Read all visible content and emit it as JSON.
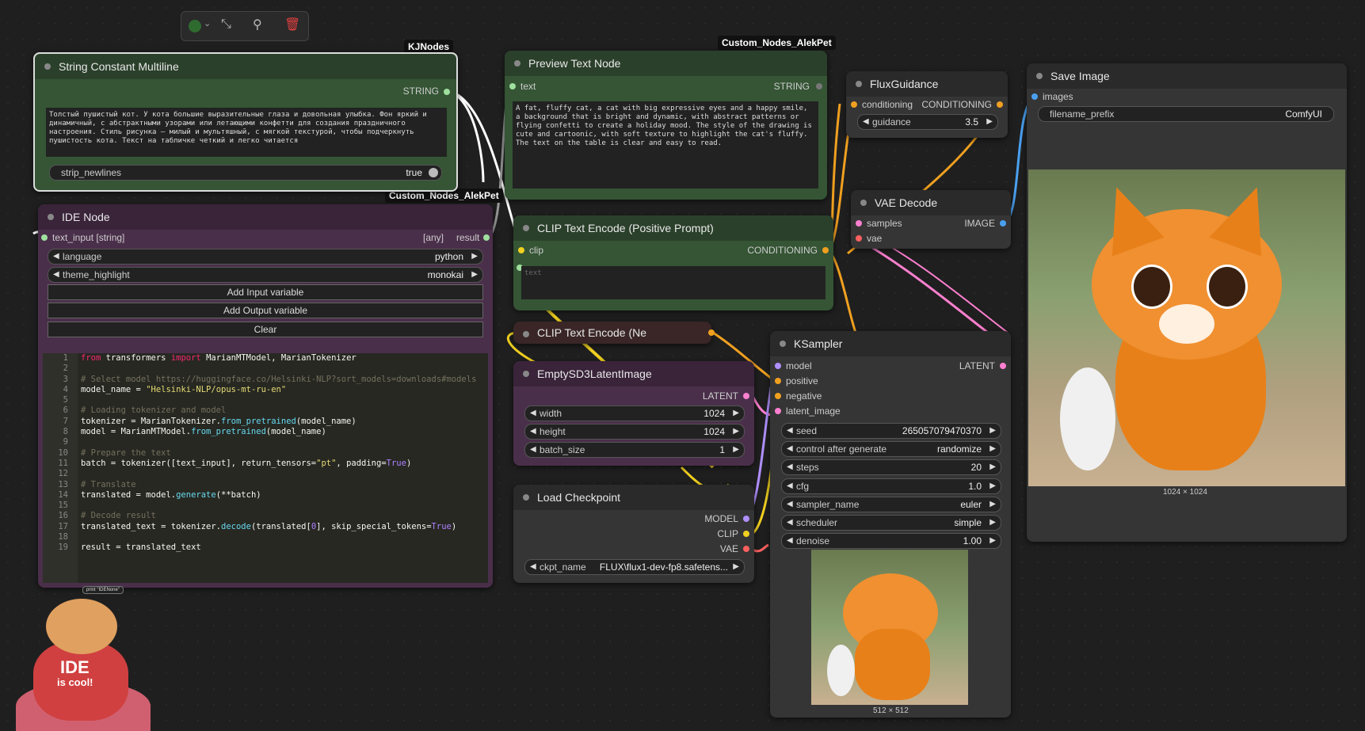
{
  "toolbar": {
    "icons": [
      "color-picker-icon",
      "bypass-icon",
      "pin-icon",
      "delete-icon"
    ]
  },
  "tags": {
    "kjnodes": "KJNodes",
    "alekpet1": "Custom_Nodes_AlekPet",
    "alekpet2": "Custom_Nodes_AlekPet"
  },
  "string_const": {
    "title": "String Constant Multiline",
    "out": "STRING",
    "text": "Толстый пушистый кот. У кота большие выразительные глаза и довольная улыбка. Фон яркий и динамичный, с абстрактными узорами или летающими конфетти для создания праздничного настроения. Стиль рисунка — милый и мультяшный, с мягкой текстурой, чтобы подчеркнуть пушистость кота. Текст на табличке четкий и легко читается",
    "strip_label": "strip_newlines",
    "strip_val": "true"
  },
  "preview": {
    "title": "Preview Text Node",
    "in": "text",
    "out": "STRING",
    "text": "A fat, fluffy cat, a cat with big expressive eyes and a happy smile, a background that is bright and dynamic, with abstract patterns or flying confetti to create a holiday mood. The style of the drawing is cute and cartoonic, with soft texture to highlight the cat's fluffy. The text on the table is clear and easy to read."
  },
  "ide": {
    "title": "IDE Node",
    "in": "text_input [string]",
    "any": "[any]",
    "out": "result",
    "language_label": "language",
    "language_val": "python",
    "theme_label": "theme_highlight",
    "theme_val": "monokai",
    "add_input": "Add Input variable",
    "add_output": "Add Output variable",
    "clear": "Clear",
    "cat_text1": "IDE",
    "cat_text2": "is cool!",
    "tooltip": "print \"IDENone\""
  },
  "flux": {
    "title": "FluxGuidance",
    "in": "conditioning",
    "out": "CONDITIONING",
    "label": "guidance",
    "val": "3.5"
  },
  "save": {
    "title": "Save Image",
    "in": "images",
    "prefix_label": "filename_prefix",
    "prefix_val": "ComfyUI",
    "size": "1024 × 1024"
  },
  "vae": {
    "title": "VAE Decode",
    "in1": "samples",
    "in2": "vae",
    "out": "IMAGE"
  },
  "clip_pos": {
    "title": "CLIP Text Encode (Positive Prompt)",
    "in": "clip",
    "out": "CONDITIONING",
    "placeholder": "text"
  },
  "clip_neg": {
    "title": "CLIP Text Encode (Ne"
  },
  "latent": {
    "title": "EmptySD3LatentImage",
    "out": "LATENT",
    "w_label": "width",
    "w_val": "1024",
    "h_label": "height",
    "h_val": "1024",
    "b_label": "batch_size",
    "b_val": "1"
  },
  "ckpt": {
    "title": "Load Checkpoint",
    "out1": "MODEL",
    "out2": "CLIP",
    "out3": "VAE",
    "label": "ckpt_name",
    "val": "FLUX\\flux1-dev-fp8.safetens..."
  },
  "ksampler": {
    "title": "KSampler",
    "in1": "model",
    "in2": "positive",
    "in3": "negative",
    "in4": "latent_image",
    "out": "LATENT",
    "w": [
      [
        "seed",
        "265057079470370"
      ],
      [
        "control after generate",
        "randomize"
      ],
      [
        "steps",
        "20"
      ],
      [
        "cfg",
        "1.0"
      ],
      [
        "sampler_name",
        "euler"
      ],
      [
        "scheduler",
        "simple"
      ],
      [
        "denoise",
        "1.00"
      ]
    ],
    "size": "512 × 512"
  },
  "code_nums": [
    "1",
    "2",
    "3",
    "4",
    "5",
    "6",
    "7",
    "8",
    "9",
    "10",
    "11",
    "12",
    "13",
    "14",
    "15",
    "16",
    "17",
    "18",
    "19"
  ]
}
